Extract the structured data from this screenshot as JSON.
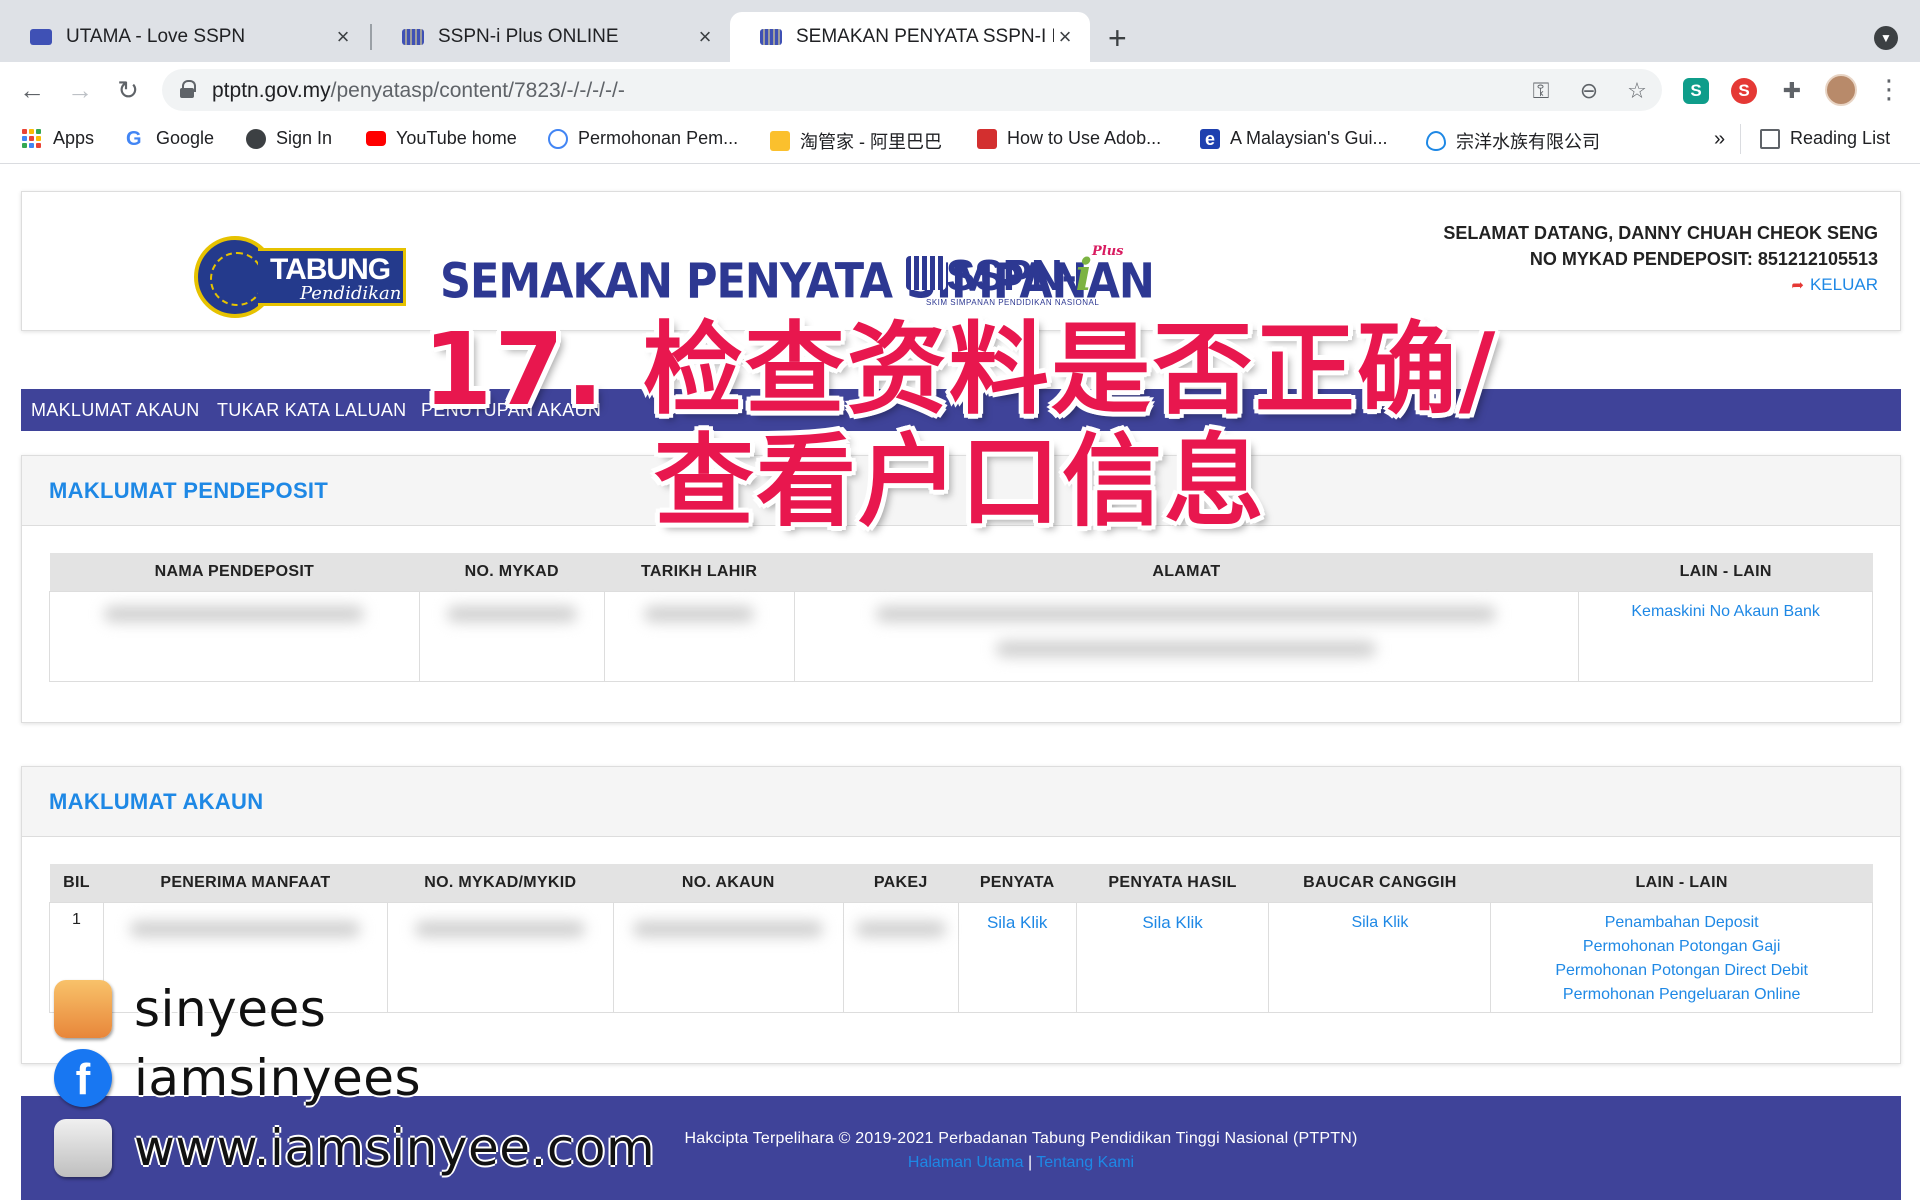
{
  "browser": {
    "tabs": [
      {
        "title": "UTAMA - Love SSPN",
        "active": false
      },
      {
        "title": "SSPN-i Plus ONLINE",
        "active": false
      },
      {
        "title": "SEMAKAN PENYATA SSPN-I PL",
        "active": true
      }
    ],
    "url_host": "ptptn.gov.my",
    "url_path": "/penyatasp/content/7823/-/-/-/-/-",
    "bookmarks": [
      {
        "label": "Apps",
        "icon": "apps-grid-icon"
      },
      {
        "label": "Google",
        "icon": "google-icon"
      },
      {
        "label": "Sign In",
        "icon": "globe-icon"
      },
      {
        "label": "YouTube home",
        "icon": "youtube-icon"
      },
      {
        "label": "Permohonan Pem...",
        "icon": "circle-icon"
      },
      {
        "label": "淘管家 - 阿里巴巴",
        "icon": "shop-icon"
      },
      {
        "label": "How to Use Adob...",
        "icon": "adobe-icon"
      },
      {
        "label": "A Malaysian's Gui...",
        "icon": "e-icon"
      },
      {
        "label": "宗洋水族有限公司",
        "icon": "eye-icon"
      }
    ],
    "more_bookmarks": "»",
    "reading_list": "Reading List"
  },
  "header": {
    "logo_word1": "TABUNG",
    "logo_word2": "Pendidikan",
    "page_title": "SEMAKAN PENYATA SIMPANAN",
    "sspn_logo": "SSPN-",
    "sspn_logo_i": "i",
    "sspn_logo_plus": "Plus",
    "sspn_tagline": "SKIM SIMPANAN PENDIDIKAN NASIONAL",
    "welcome": "SELAMAT DATANG, DANNY CHUAH CHEOK SENG",
    "mykad_line": "NO MYKAD PENDEPOSIT: 851212105513",
    "logout": "KELUAR"
  },
  "menu": [
    "MAKLUMAT AKAUN",
    "TUKAR KATA LALUAN",
    "PENUTUPAN AKAUN"
  ],
  "overlay": {
    "line1": "17. 检查资料是否正确/",
    "line2": "查看户口信息"
  },
  "pendeposit": {
    "heading": "MAKLUMAT PENDEPOSIT",
    "columns": [
      "NAMA PENDEPOSIT",
      "NO. MYKAD",
      "TARIKH LAHIR",
      "ALAMAT",
      "LAIN - LAIN"
    ],
    "action": "Kemaskini No Akaun Bank"
  },
  "akaun": {
    "heading": "MAKLUMAT AKAUN",
    "columns": [
      "BIL",
      "PENERIMA MANFAAT",
      "NO. MYKAD/MYKID",
      "NO. AKAUN",
      "PAKEJ",
      "PENYATA",
      "PENYATA HASIL",
      "BAUCAR CANGGIH",
      "LAIN - LAIN"
    ],
    "row": {
      "bil": "1",
      "penyata": "Sila Klik",
      "penyata_hasil": "Sila Klik",
      "baucar": "Sila Klik",
      "others": [
        "Penambahan Deposit",
        "Permohonan Potongan Gaji",
        "Permohonan Potongan Direct Debit",
        "Permohonan Pengeluaran Online"
      ]
    }
  },
  "footer": {
    "copyright": "Hakcipta Terpelihara © 2019-2021 Perbadanan Tabung Pendidikan Tinggi Nasional (PTPTN)",
    "link_home": "Halaman Utama",
    "separator": "|",
    "link_about": "Tentang Kami"
  },
  "watermark": {
    "instagram": "sinyees",
    "facebook": "iamsinyees",
    "website": "www.iamsinyee.com"
  },
  "colors": {
    "menu_bar": "#3f4399",
    "link": "#1e88e5",
    "overlay_text": "#e8174e"
  }
}
